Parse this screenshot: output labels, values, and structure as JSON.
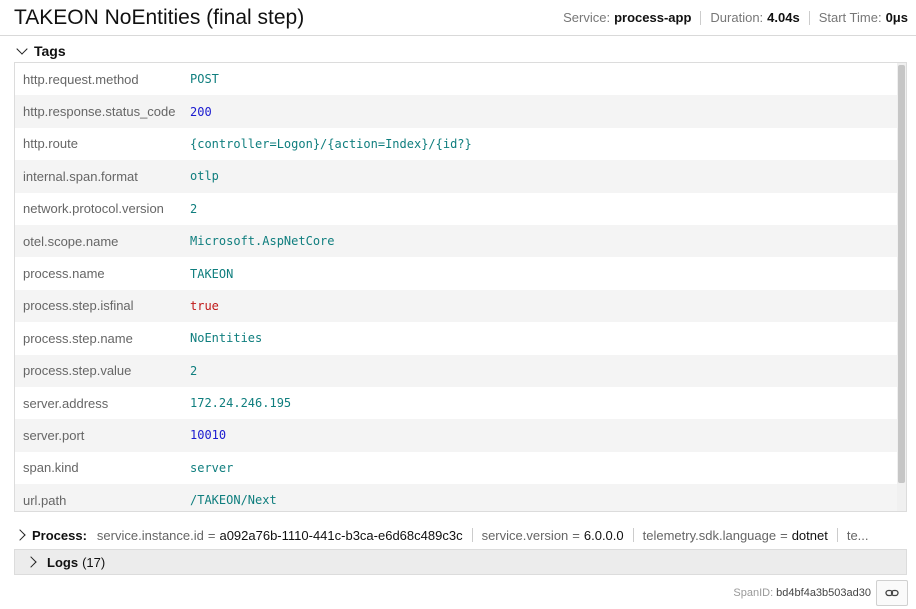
{
  "header": {
    "title": "TAKEON NoEntities (final step)",
    "service_label": "Service:",
    "service_value": "process-app",
    "duration_label": "Duration:",
    "duration_value": "4.04s",
    "start_label": "Start Time:",
    "start_value": "0μs"
  },
  "tags": {
    "label": "Tags",
    "rows": [
      {
        "key": "http.request.method",
        "value": "POST",
        "type": "string"
      },
      {
        "key": "http.response.status_code",
        "value": "200",
        "type": "number"
      },
      {
        "key": "http.route",
        "value": "{controller=Logon}/{action=Index}/{id?}",
        "type": "string"
      },
      {
        "key": "internal.span.format",
        "value": "otlp",
        "type": "string"
      },
      {
        "key": "network.protocol.version",
        "value": "2",
        "type": "string"
      },
      {
        "key": "otel.scope.name",
        "value": "Microsoft.AspNetCore",
        "type": "string"
      },
      {
        "key": "process.name",
        "value": "TAKEON",
        "type": "string"
      },
      {
        "key": "process.step.isfinal",
        "value": "true",
        "type": "bool"
      },
      {
        "key": "process.step.name",
        "value": "NoEntities",
        "type": "string"
      },
      {
        "key": "process.step.value",
        "value": "2",
        "type": "string"
      },
      {
        "key": "server.address",
        "value": "172.24.246.195",
        "type": "string"
      },
      {
        "key": "server.port",
        "value": "10010",
        "type": "number"
      },
      {
        "key": "span.kind",
        "value": "server",
        "type": "string"
      },
      {
        "key": "url.path",
        "value": "/TAKEON/Next",
        "type": "string"
      }
    ]
  },
  "process": {
    "label": "Process:",
    "items": [
      {
        "key": "service.instance.id",
        "value": "a092a76b-1110-441c-b3ca-e6d68c489c3c"
      },
      {
        "key": "service.version",
        "value": "6.0.0.0"
      },
      {
        "key": "telemetry.sdk.language",
        "value": "dotnet"
      },
      {
        "key": "te...",
        "value": ""
      }
    ]
  },
  "logs": {
    "label": "Logs",
    "count": "(17)"
  },
  "footer": {
    "span_label": "SpanID:",
    "span_value": "bd4bf4a3b503ad30",
    "link_icon": "link-icon"
  },
  "colors": {
    "string_value": "#0f7e7e",
    "number_value": "#1b1bd0",
    "bool_value": "#c01818"
  }
}
